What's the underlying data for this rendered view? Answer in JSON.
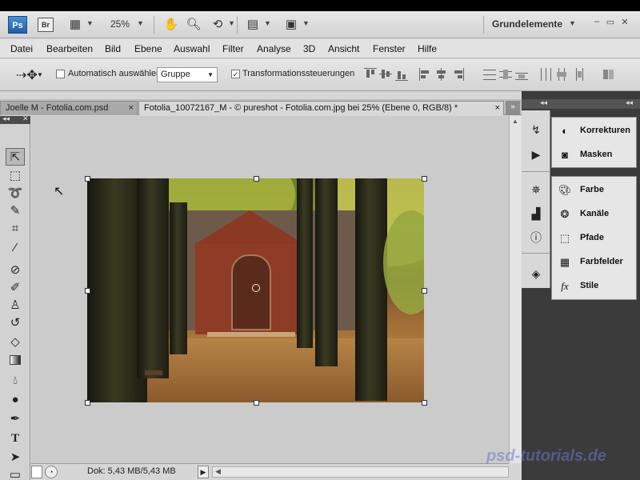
{
  "app_bar": {
    "ps_logo": "Ps",
    "br_logo": "Br",
    "zoom": "25%",
    "workspace": "Grundelemente",
    "window_controls": [
      "–",
      "▭",
      "✕"
    ]
  },
  "menu": [
    "Datei",
    "Bearbeiten",
    "Bild",
    "Ebene",
    "Auswahl",
    "Filter",
    "Analyse",
    "3D",
    "Ansicht",
    "Fenster",
    "Hilfe"
  ],
  "options_bar": {
    "auto_select_label": "Automatisch auswählen:",
    "auto_select_checked": false,
    "auto_select_value": "Gruppe",
    "transform_label": "Transformationssteuerungen",
    "transform_checked": true
  },
  "tabs": [
    {
      "label": "Joelle M - Fotolia.com.psd",
      "active": false
    },
    {
      "label": "Fotolia_10072167_M - © pureshot - Fotolia.com.jpg bei 25% (Ebene 0, RGB/8) *",
      "active": true
    }
  ],
  "tab_close": "×",
  "tab_more": "»",
  "status_bar": {
    "doc_info": "Dok: 5,43 MB/5,43 MB"
  },
  "panels": {
    "group1": [
      {
        "label": "Korrekturen",
        "icon": "adjustments-icon"
      },
      {
        "label": "Masken",
        "icon": "masks-icon"
      }
    ],
    "group2": [
      {
        "label": "Farbe",
        "icon": "color-palette-icon"
      },
      {
        "label": "Kanäle",
        "icon": "channels-icon"
      },
      {
        "label": "Pfade",
        "icon": "paths-icon"
      },
      {
        "label": "Farbfelder",
        "icon": "swatches-icon"
      },
      {
        "label": "Stile",
        "icon": "styles-fx-icon"
      }
    ]
  },
  "watermark": "psd-tutorials.de"
}
